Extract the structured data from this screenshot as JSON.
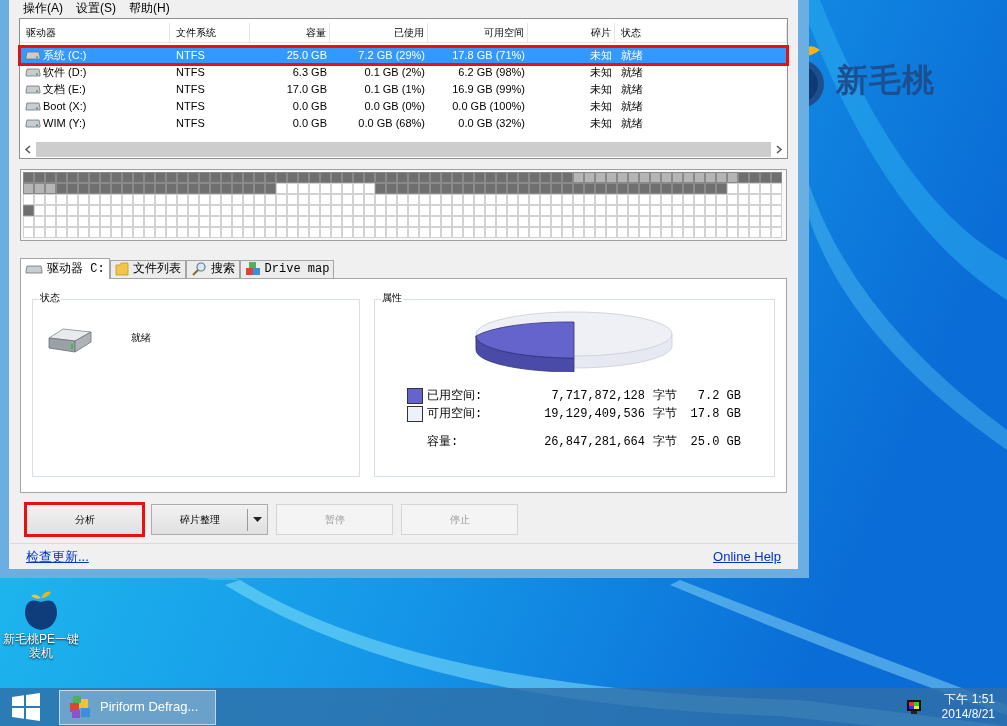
{
  "menu": [
    "操作(A)",
    "设置(S)",
    "帮助(H)"
  ],
  "drive_table": {
    "columns": [
      "驱动器",
      "文件系统",
      "容量",
      "已使用",
      "可用空间",
      "碎片",
      "状态"
    ],
    "rows": [
      {
        "cells": [
          "系统 (C:)",
          "NTFS",
          "25.0 GB",
          "7.2 GB (29%)",
          "17.8 GB (71%)",
          "未知",
          "就绪"
        ],
        "selected": true,
        "annotated": true
      },
      {
        "cells": [
          "软件 (D:)",
          "NTFS",
          "6.3 GB",
          "0.1 GB (2%)",
          "6.2 GB (98%)",
          "未知",
          "就绪"
        ],
        "selected": false,
        "annotated": false
      },
      {
        "cells": [
          "文档 (E:)",
          "NTFS",
          "17.0 GB",
          "0.1 GB (1%)",
          "16.9 GB (99%)",
          "未知",
          "就绪"
        ],
        "selected": false,
        "annotated": false
      },
      {
        "cells": [
          "Boot (X:)",
          "NTFS",
          "0.0 GB",
          "0.0 GB (0%)",
          "0.0 GB (100%)",
          "未知",
          "就绪"
        ],
        "selected": false,
        "annotated": false
      },
      {
        "cells": [
          "WIM (Y:)",
          "NTFS",
          "0.0 GB",
          "0.0 GB (68%)",
          "0.0 GB (32%)",
          "未知",
          "就绪"
        ],
        "selected": false,
        "annotated": false
      }
    ]
  },
  "tabs": [
    {
      "label": "驱动器 C:",
      "selected": true
    },
    {
      "label": "文件列表",
      "selected": false
    },
    {
      "label": "搜索",
      "selected": false
    },
    {
      "label": "Drive map",
      "selected": false
    }
  ],
  "status_panel": {
    "title": "状态",
    "status": "就绪"
  },
  "properties_panel": {
    "title": "属性",
    "legend": [
      {
        "kind": "swatch",
        "color": "#6464cc",
        "label": "已用空间:",
        "bytes": "7,717,872,128",
        "unit": "字节",
        "size": "7.2 GB"
      },
      {
        "kind": "swatch",
        "color": "#eef2f8",
        "label": "可用空间:",
        "bytes": "19,129,409,536",
        "unit": "字节",
        "size": "17.8 GB"
      },
      {
        "kind": "total",
        "label": "容量:",
        "bytes": "26,847,281,664",
        "unit": "字节",
        "size": "25.0 GB"
      }
    ]
  },
  "buttons": [
    {
      "label": "分析",
      "kind": "plain",
      "disabled": false,
      "annotated": true
    },
    {
      "label": "碎片整理",
      "kind": "split",
      "disabled": false,
      "annotated": false
    },
    {
      "label": "暂停",
      "kind": "plain",
      "disabled": true,
      "annotated": false
    },
    {
      "label": "停止",
      "kind": "plain",
      "disabled": true,
      "annotated": false
    }
  ],
  "footer_links": [
    "检查更新...",
    "Online Help"
  ],
  "wallpaper_logo": "新毛桃",
  "desktop_icons": [
    {
      "label": "新毛桃PE一键装机"
    }
  ],
  "taskbar": {
    "apps": [
      {
        "label": "Piriform Defrag...",
        "selected": true
      }
    ],
    "clock": {
      "time": "下午 1:51",
      "date": "2014/8/21"
    }
  }
}
